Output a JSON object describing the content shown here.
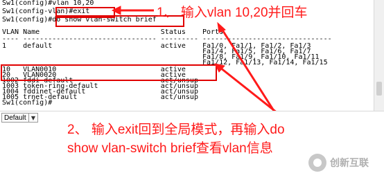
{
  "terminal": {
    "lines": [
      "Sw1(config)#vlan 10,20",
      "Sw1(config-vlan)#exit",
      "Sw1(config)#do show vlan-switch brief",
      "",
      "VLAN Name                             Status    Ports",
      "---- -------------------------------- --------- -------------------------------",
      "1    default                          active    Fa1/0, Fa1/1, Fa1/2, Fa1/3",
      "                                                Fa1/4, Fa1/5, Fa1/6, Fa1/7",
      "                                                Fa1/8, Fa1/9, Fa1/10, Fa1/11",
      "                                                Fa1/12, Fa1/13, Fa1/14, Fa1/15",
      "10   VLAN0010                         active",
      "20   VLAN0020                         active",
      "1002 fddi-default                     act/unsup",
      "1003 token-ring-default               act/unsup",
      "1004 fddinet-default                  act/unsup",
      "1005 trnet-default                    act/unsup",
      "Sw1(config)#"
    ]
  },
  "annotations": {
    "step1": "1、 输入vlan 10,20并回车",
    "step2_line1": "2、 输入exit回到全局模式，再输入do",
    "step2_line2": "show vlan-switch brief查看vlan信息"
  },
  "session": {
    "selected": "Default"
  },
  "watermark": {
    "text": "创新互联"
  },
  "colors": {
    "annotation": "#ff1a1a",
    "terminal_text": "#000000"
  }
}
